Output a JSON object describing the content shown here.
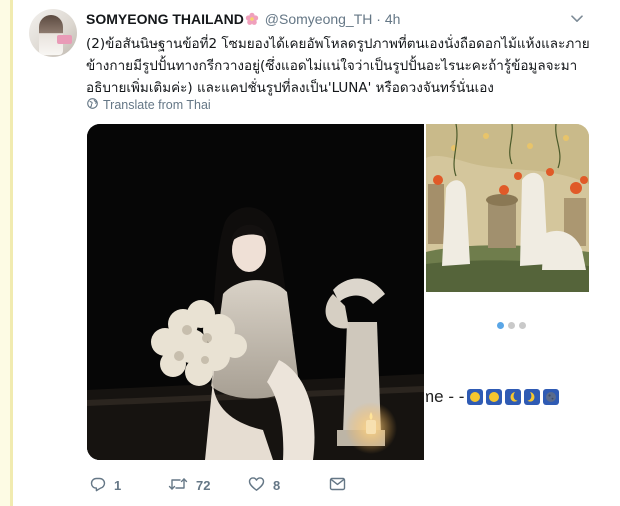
{
  "tweet": {
    "display_name": "SOMYEONG THAILAND",
    "handle": "@Somyeong_TH",
    "separator": "·",
    "time": "4h",
    "text_lines": [
      "(2)ข้อสันนิษฐานข้อที่2 โซมยองได้เคยอัพโหลดรูปภาพที่ตนเองนั่งถือดอกไม้แห้งและภาย",
      "ข้างกายมีรูปปั้นทางกรีกวางอยู่(ซึ่งแอดไม่แน่ใจว่าเป็นรูปปั้นอะไรนะคะถ้ารู้ข้อมูลจะมา",
      "อธิบายเพิ่มเติมค่ะ) และแคปชั่นรูปที่ลงเป็น'LUNA' หรือดวงจันทร์นั่นเอง"
    ],
    "translate_label": "Translate from Thai",
    "media": {
      "caption_text": "me - -",
      "carousel": {
        "count": 3,
        "active": 0
      }
    },
    "actions": {
      "replies": "1",
      "retweets": "72",
      "likes": "8"
    }
  },
  "colors": {
    "accent": "#1da1f2",
    "muted": "#657786",
    "rail": "#f1ebb0",
    "flower": "#f0a0bc"
  },
  "icons": [
    "flower-icon",
    "chevron-down-icon",
    "globe-icon",
    "reply-icon",
    "retweet-icon",
    "heart-icon",
    "direct-message-icon",
    "moon-emoji-icon"
  ]
}
